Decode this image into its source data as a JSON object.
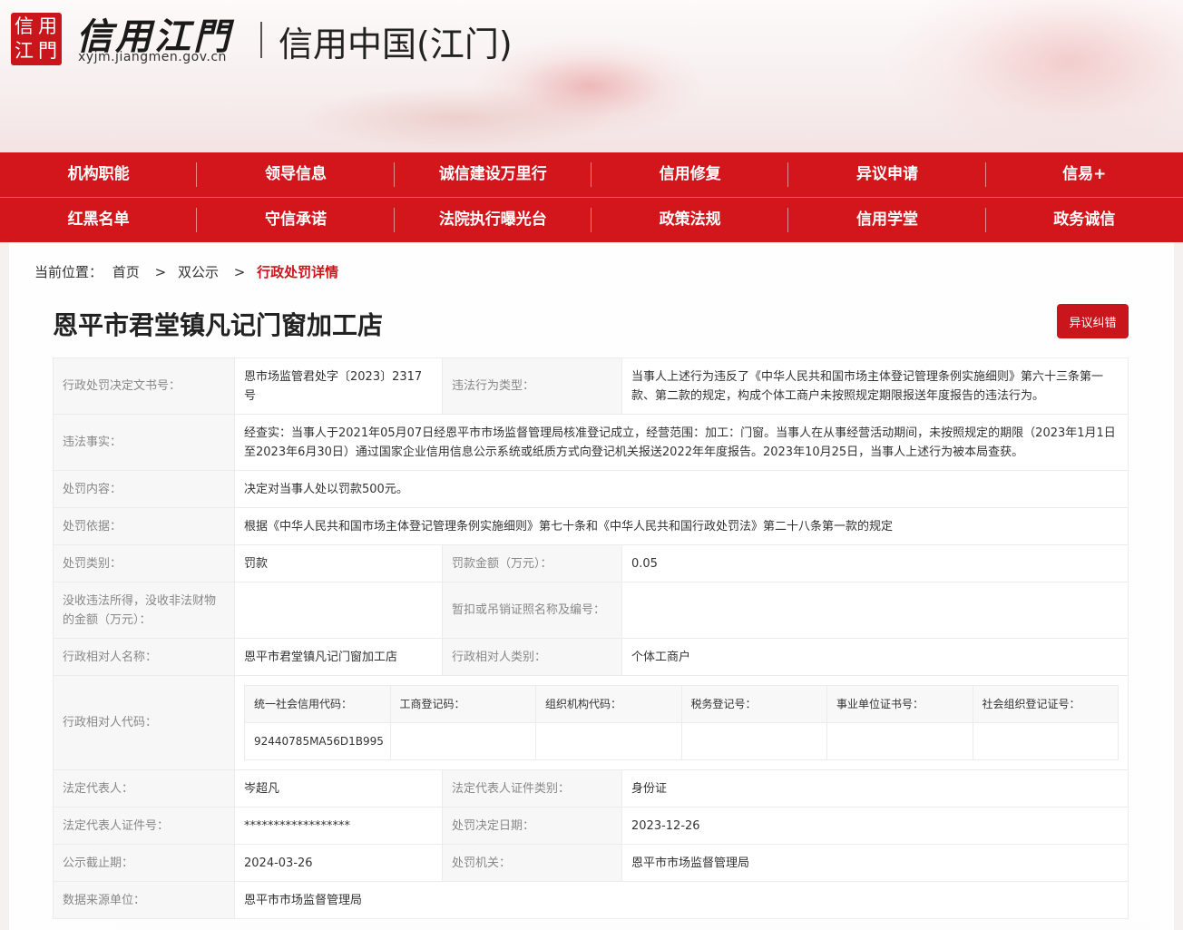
{
  "header": {
    "seal_chars": [
      "信",
      "用",
      "江",
      "門"
    ],
    "logo_text": "信用江門",
    "logo_url": "xyjm.jiangmen.gov.cn",
    "site_title": "信用中国(江门)"
  },
  "nav": {
    "row1": [
      "机构职能",
      "领导信息",
      "诚信建设万里行",
      "信用修复",
      "异议申请",
      "信易+"
    ],
    "row2": [
      "红黑名单",
      "守信承诺",
      "法院执行曝光台",
      "政策法规",
      "信用学堂",
      "政务诚信"
    ]
  },
  "breadcrumb": {
    "label": "当前位置：",
    "home": "首页",
    "sep": ">",
    "section": "双公示",
    "current": "行政处罚详情"
  },
  "page": {
    "title": "恩平市君堂镇凡记门窗加工店",
    "objection_button": "异议纠错"
  },
  "detail": {
    "doc_no_label": "行政处罚决定文书号：",
    "doc_no": "恩市场监管君处字〔2023〕2317号",
    "violation_type_label": "违法行为类型：",
    "violation_type": "当事人上述行为违反了《中华人民共和国市场主体登记管理条例实施细则》第六十三条第一款、第二款的规定，构成个体工商户未按照规定期限报送年度报告的违法行为。",
    "facts_label": "违法事实：",
    "facts": "经查实：当事人于2021年05月07日经恩平市市场监督管理局核准登记成立，经营范围：加工：门窗。当事人在从事经营活动期间，未按照规定的期限（2023年1月1日至2023年6月30日）通过国家企业信用信息公示系统或纸质方式向登记机关报送2022年年度报告。2023年10月25日，当事人上述行为被本局查获。",
    "content_label": "处罚内容：",
    "content": "决定对当事人处以罚款500元。",
    "basis_label": "处罚依据：",
    "basis": "根据《中华人民共和国市场主体登记管理条例实施细则》第七十条和《中华人民共和国行政处罚法》第二十八条第一款的规定",
    "category_label": "处罚类别：",
    "category": "罚款",
    "fine_label": "罚款金额（万元）：",
    "fine": "0.05",
    "confiscation_label": "没收违法所得，没收非法财物的金额（万元）：",
    "confiscation": "",
    "license_label": "暂扣或吊销证照名称及编号：",
    "license": "",
    "party_name_label": "行政相对人名称：",
    "party_name": "恩平市君堂镇凡记门窗加工店",
    "party_type_label": "行政相对人类别：",
    "party_type": "个体工商户",
    "party_code_label": "行政相对人代码：",
    "code_headers": [
      "统一社会信用代码：",
      "工商登记码：",
      "组织机构代码：",
      "税务登记号：",
      "事业单位证书号：",
      "社会组织登记证号："
    ],
    "code_values": [
      "92440785MA56D1B995",
      "",
      "",
      "",
      "",
      ""
    ],
    "legal_rep_label": "法定代表人：",
    "legal_rep": "岑超凡",
    "id_type_label": "法定代表人证件类别：",
    "id_type": "身份证",
    "id_no_label": "法定代表人证件号：",
    "id_no": "******************",
    "decision_date_label": "处罚决定日期：",
    "decision_date": "2023-12-26",
    "deadline_label": "公示截止期：",
    "deadline": "2024-03-26",
    "authority_label": "处罚机关：",
    "authority": "恩平市市场监督管理局",
    "source_label": "数据来源单位：",
    "source": "恩平市市场监督管理局"
  }
}
